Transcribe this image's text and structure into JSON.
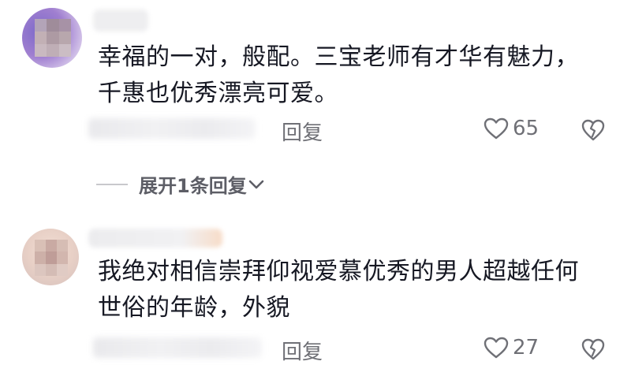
{
  "comments": [
    {
      "text_lines": [
        "幸福的一对，般配。三宝老师有才华有魅力，",
        "千惠也优秀漂亮可爱。"
      ],
      "reply_label": "回复",
      "likes": "65",
      "icons": {
        "like": "heart-outline-icon",
        "dislike": "broken-heart-icon"
      }
    },
    {
      "text_lines": [
        "我绝对相信崇拜仰视爱慕优秀的男人超越任何",
        "世俗的年龄，外貌"
      ],
      "reply_label": "回复",
      "likes": "27",
      "icons": {
        "like": "heart-outline-icon",
        "dislike": "broken-heart-icon"
      }
    }
  ],
  "expand_replies": {
    "label": "展开1条回复",
    "icon": "chevron-down-icon"
  },
  "colors": {
    "text": "#161823",
    "secondary": "#6f7076",
    "expand": "#5d5e66"
  }
}
